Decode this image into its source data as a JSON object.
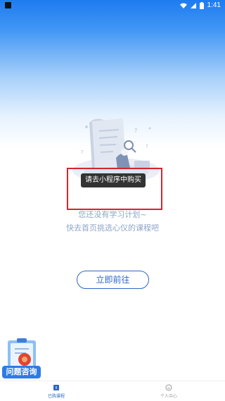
{
  "status_bar": {
    "time": "1:41"
  },
  "toast": {
    "text": "请去小程序中购买"
  },
  "empty_state": {
    "line1": "您还没有学习计划~",
    "line2": "快去首页挑选心仪的课程吧"
  },
  "go_button": {
    "label": "立即前往"
  },
  "help_widget": {
    "label": "问题咨询"
  },
  "tabs": [
    {
      "label": "已购课程",
      "active": true,
      "icon": "book-icon"
    },
    {
      "label": "个人中心",
      "active": false,
      "icon": "user-icon"
    }
  ],
  "colors": {
    "accent": "#2E66C8",
    "highlight_box": "#D9232E",
    "toast_bg": "#333333",
    "header_blue": "#1E7CF0"
  }
}
